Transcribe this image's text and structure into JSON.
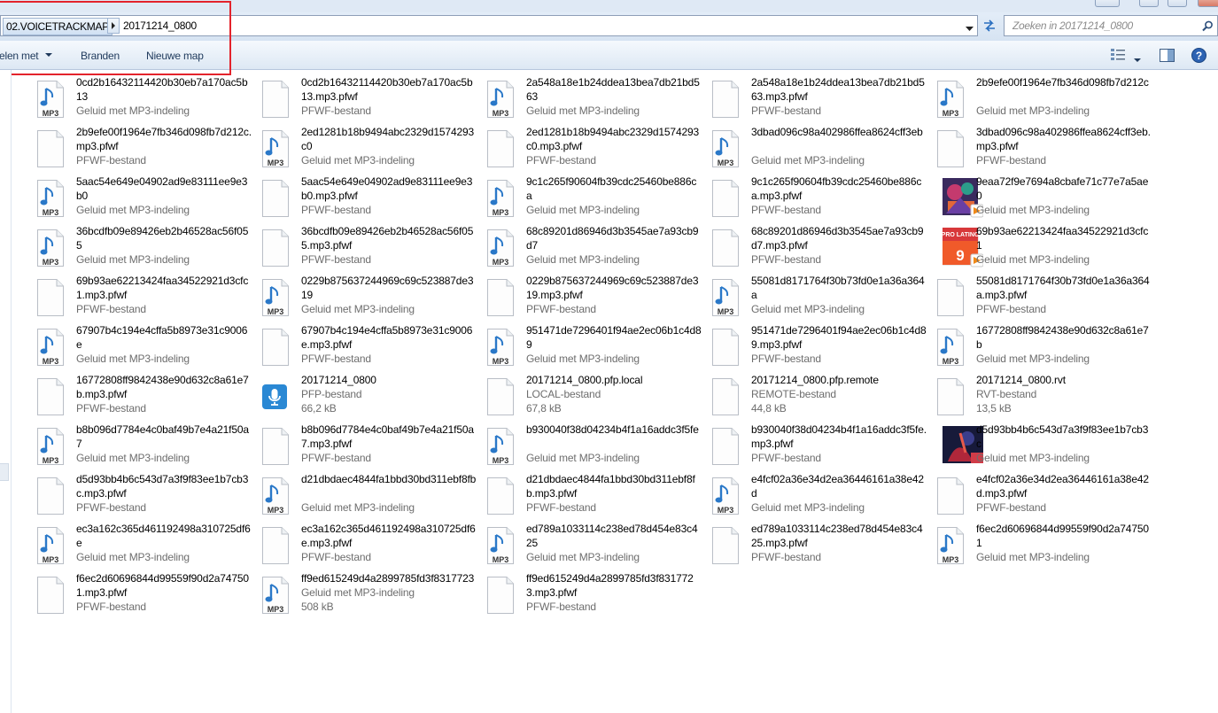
{
  "address": {
    "crumbs": [
      "02.VOICETRACKMAP",
      "20171214_0800"
    ],
    "separator_icon": "chevron-right-icon",
    "dropdown_icon": "chevron-down-icon",
    "refresh_icon": "refresh-icon"
  },
  "search": {
    "placeholder": "Zoeken in 20171214_0800",
    "icon": "search-icon"
  },
  "toolbar": {
    "share_label": "elen met",
    "burn_label": "Branden",
    "new_folder_label": "Nieuwe map",
    "view_icon": "change-view-icon",
    "preview_icon": "preview-pane-icon",
    "help_icon": "help-icon"
  },
  "highlight_color": "#e3232c",
  "files": [
    {
      "name": "0cd2b16432114420b30eb7a170ac5b13",
      "type": "Geluid met MP3-indeling",
      "icon": "mp3"
    },
    {
      "name": "0cd2b16432114420b30eb7a170ac5b13.mp3.pfwf",
      "type": "PFWF-bestand",
      "icon": "blank"
    },
    {
      "name": "2a548a18e1b24ddea13bea7db21bd563",
      "type": "Geluid met MP3-indeling",
      "icon": "mp3"
    },
    {
      "name": "2a548a18e1b24ddea13bea7db21bd563.mp3.pfwf",
      "type": "PFWF-bestand",
      "icon": "blank"
    },
    {
      "name": "2b9efe00f1964e7fb346d098fb7d212c",
      "type": "Geluid met MP3-indeling",
      "icon": "mp3"
    },
    {
      "name": "2b9efe00f1964e7fb346d098fb7d212c.mp3.pfwf",
      "type": "PFWF-bestand",
      "icon": "blank"
    },
    {
      "name": "2ed1281b18b9494abc2329d1574293c0",
      "type": "Geluid met MP3-indeling",
      "icon": "mp3"
    },
    {
      "name": "2ed1281b18b9494abc2329d1574293c0.mp3.pfwf",
      "type": "PFWF-bestand",
      "icon": "blank"
    },
    {
      "name": "3dbad096c98a402986ffea8624cff3eb",
      "type": "Geluid met MP3-indeling",
      "icon": "mp3"
    },
    {
      "name": "3dbad096c98a402986ffea8624cff3eb.mp3.pfwf",
      "type": "PFWF-bestand",
      "icon": "blank"
    },
    {
      "name": "5aac54e649e04902ad9e83111ee9e3b0",
      "type": "Geluid met MP3-indeling",
      "icon": "mp3"
    },
    {
      "name": "5aac54e649e04902ad9e83111ee9e3b0.mp3.pfwf",
      "type": "PFWF-bestand",
      "icon": "blank"
    },
    {
      "name": "9c1c265f90604fb39cdc25460be886ca",
      "type": "Geluid met MP3-indeling",
      "icon": "mp3"
    },
    {
      "name": "9c1c265f90604fb39cdc25460be886ca.mp3.pfwf",
      "type": "PFWF-bestand",
      "icon": "blank"
    },
    {
      "name": "9eaa72f9e7694a8cbafe71c77e7a5ae0",
      "type": "Geluid met MP3-indeling",
      "icon": "art1"
    },
    {
      "name": "36bcdfb09e89426eb2b46528ac56f055",
      "type": "Geluid met MP3-indeling",
      "icon": "mp3"
    },
    {
      "name": "36bcdfb09e89426eb2b46528ac56f055.mp3.pfwf",
      "type": "PFWF-bestand",
      "icon": "blank"
    },
    {
      "name": "68c89201d86946d3b3545ae7a93cb9d7",
      "type": "Geluid met MP3-indeling",
      "icon": "mp3"
    },
    {
      "name": "68c89201d86946d3b3545ae7a93cb9d7.mp3.pfwf",
      "type": "PFWF-bestand",
      "icon": "blank"
    },
    {
      "name": "69b93ae62213424faa34522921d3cfc1",
      "type": "Geluid met MP3-indeling",
      "icon": "art2"
    },
    {
      "name": "69b93ae62213424faa34522921d3cfc1.mp3.pfwf",
      "type": "PFWF-bestand",
      "icon": "blank"
    },
    {
      "name": "0229b875637244969c69c523887de319",
      "type": "Geluid met MP3-indeling",
      "icon": "mp3"
    },
    {
      "name": "0229b875637244969c69c523887de319.mp3.pfwf",
      "type": "PFWF-bestand",
      "icon": "blank"
    },
    {
      "name": "55081d8171764f30b73fd0e1a36a364a",
      "type": "Geluid met MP3-indeling",
      "icon": "mp3"
    },
    {
      "name": "55081d8171764f30b73fd0e1a36a364a.mp3.pfwf",
      "type": "PFWF-bestand",
      "icon": "blank"
    },
    {
      "name": "67907b4c194e4cffa5b8973e31c9006e",
      "type": "Geluid met MP3-indeling",
      "icon": "mp3"
    },
    {
      "name": "67907b4c194e4cffa5b8973e31c9006e.mp3.pfwf",
      "type": "PFWF-bestand",
      "icon": "blank"
    },
    {
      "name": "951471de7296401f94ae2ec06b1c4d89",
      "type": "Geluid met MP3-indeling",
      "icon": "mp3"
    },
    {
      "name": "951471de7296401f94ae2ec06b1c4d89.mp3.pfwf",
      "type": "PFWF-bestand",
      "icon": "blank"
    },
    {
      "name": "16772808ff9842438e90d632c8a61e7b",
      "type": "Geluid met MP3-indeling",
      "icon": "mp3"
    },
    {
      "name": "16772808ff9842438e90d632c8a61e7b.mp3.pfwf",
      "type": "PFWF-bestand",
      "icon": "blank"
    },
    {
      "name": "20171214_0800",
      "type": "PFP-bestand",
      "size": "66,2 kB",
      "icon": "pfp"
    },
    {
      "name": "20171214_0800.pfp.local",
      "type": "LOCAL-bestand",
      "size": "67,8 kB",
      "icon": "blank"
    },
    {
      "name": "20171214_0800.pfp.remote",
      "type": "REMOTE-bestand",
      "size": "44,8 kB",
      "icon": "blank"
    },
    {
      "name": "20171214_0800.rvt",
      "type": "RVT-bestand",
      "size": "13,5 kB",
      "icon": "blank"
    },
    {
      "name": "b8b096d7784e4c0baf49b7e4a21f50a7",
      "type": "Geluid met MP3-indeling",
      "icon": "mp3"
    },
    {
      "name": "b8b096d7784e4c0baf49b7e4a21f50a7.mp3.pfwf",
      "type": "PFWF-bestand",
      "icon": "blank"
    },
    {
      "name": "b930040f38d04234b4f1a16addc3f5fe",
      "type": "Geluid met MP3-indeling",
      "icon": "mp3"
    },
    {
      "name": "b930040f38d04234b4f1a16addc3f5fe.mp3.pfwf",
      "type": "PFWF-bestand",
      "icon": "blank"
    },
    {
      "name": "d5d93bb4b6c543d7a3f9f83ee1b7cb3c",
      "type": "Geluid met MP3-indeling",
      "icon": "art3"
    },
    {
      "name": "d5d93bb4b6c543d7a3f9f83ee1b7cb3c.mp3.pfwf",
      "type": "PFWF-bestand",
      "icon": "blank"
    },
    {
      "name": "d21dbdaec4844fa1bbd30bd311ebf8fb",
      "type": "Geluid met MP3-indeling",
      "icon": "mp3"
    },
    {
      "name": "d21dbdaec4844fa1bbd30bd311ebf8fb.mp3.pfwf",
      "type": "PFWF-bestand",
      "icon": "blank"
    },
    {
      "name": "e4fcf02a36e34d2ea36446161a38e42d",
      "type": "Geluid met MP3-indeling",
      "icon": "mp3"
    },
    {
      "name": "e4fcf02a36e34d2ea36446161a38e42d.mp3.pfwf",
      "type": "PFWF-bestand",
      "icon": "blank"
    },
    {
      "name": "ec3a162c365d461192498a310725df6e",
      "type": "Geluid met MP3-indeling",
      "icon": "mp3"
    },
    {
      "name": "ec3a162c365d461192498a310725df6e.mp3.pfwf",
      "type": "PFWF-bestand",
      "icon": "blank"
    },
    {
      "name": "ed789a1033114c238ed78d454e83c425",
      "type": "Geluid met MP3-indeling",
      "icon": "mp3"
    },
    {
      "name": "ed789a1033114c238ed78d454e83c425.mp3.pfwf",
      "type": "PFWF-bestand",
      "icon": "blank"
    },
    {
      "name": "f6ec2d60696844d99559f90d2a747501",
      "type": "Geluid met MP3-indeling",
      "icon": "mp3"
    },
    {
      "name": "f6ec2d60696844d99559f90d2a747501.mp3.pfwf",
      "type": "PFWF-bestand",
      "icon": "blank"
    },
    {
      "name": "ff9ed615249d4a2899785fd3f8317723",
      "type": "Geluid met MP3-indeling",
      "size": "508 kB",
      "icon": "mp3"
    },
    {
      "name": "ff9ed615249d4a2899785fd3f8317723.mp3.pfwf",
      "type": "PFWF-bestand",
      "icon": "blank"
    }
  ]
}
